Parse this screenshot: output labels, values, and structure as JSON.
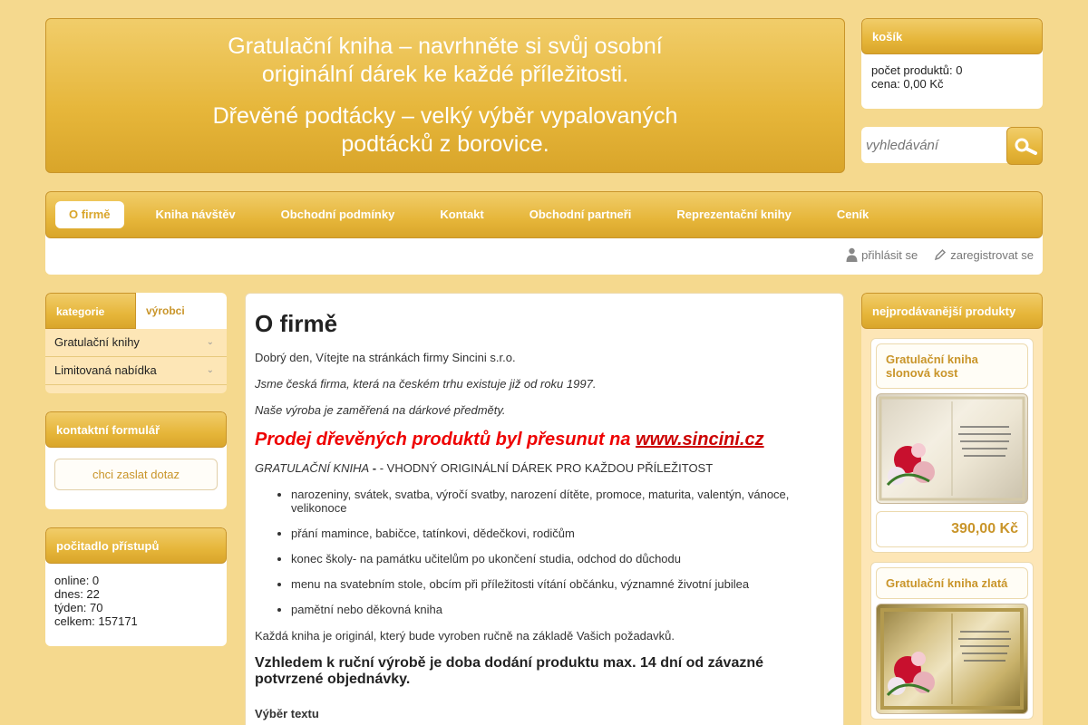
{
  "banner": {
    "line1": "Gratulační kniha – navrhněte si svůj osobní",
    "line2": "originální dárek ke každé příležitosti.",
    "line3": "Dřevěné podtácky – velký výběr vypalovaných",
    "line4": "podtácků z borovice."
  },
  "cart": {
    "title": "košík",
    "count_label": "počet produktů: 0",
    "price_label": "cena: 0,00 Kč"
  },
  "search": {
    "placeholder": "vyhledávání",
    "icon": "magnifier-icon"
  },
  "nav": {
    "items": [
      {
        "label": "O firmě",
        "active": true
      },
      {
        "label": "Kniha návštěv"
      },
      {
        "label": "Obchodní podmínky"
      },
      {
        "label": "Kontakt"
      },
      {
        "label": "Obchodní partneři"
      },
      {
        "label": "Reprezentační knihy"
      },
      {
        "label": "Ceník"
      }
    ]
  },
  "user": {
    "login": "přihlásit se",
    "register": "zaregistrovat se"
  },
  "categories": {
    "tab_active": "kategorie",
    "tab_inactive": "výrobci",
    "items": [
      "Gratulační knihy",
      "Limitovaná nabídka"
    ]
  },
  "contact": {
    "title": "kontaktní formulář",
    "button": "chci zaslat dotaz"
  },
  "counter": {
    "title": "počitadlo přístupů",
    "online": "online: 0",
    "today": "dnes: 22",
    "week": "týden: 70",
    "total": "celkem: 157171"
  },
  "main": {
    "title": "O firmě",
    "p1": "Dobrý den, Vítejte na stránkách firmy Sincini s.r.o.",
    "p2": "Jsme česká firma, která na českém trhu existuje již od roku 1997.",
    "p3": "Naše výroba je zaměřená na dárkové předměty.",
    "promo_text": "Prodej dřevěných produktů byl přesunut na ",
    "promo_link": "www.sincini.cz",
    "book_lead": "GRATULAČNÍ KNIHA",
    "book_rest": " - VHODNÝ ORIGINÁLNÍ DÁREK PRO KAŽDOU PŘÍLEŽITOST",
    "list": [
      "narozeniny, svátek, svatba, výročí svatby, narození dítěte, promoce, maturita, valentýn, vánoce, velikonoce",
      "přání mamince, babičce, tatínkovi, dědečkovi, rodičům",
      "konec školy- na památku učitelům po ukončení studia, odchod do důchodu",
      "menu na svatebním stole, obcím při příležitosti vítání občánku, významné životní jubilea",
      "pamětní nebo děkovná kniha"
    ],
    "p4": "Každá kniha je originál, který bude vyroben ručně na základě Vašich požadavků.",
    "h2": "Vzhledem k ruční výrobě je doba dodání produktu max. 14 dní od závazné potvrzené objednávky.",
    "h3": "Výběr textu"
  },
  "bestsellers": {
    "title": "nejprodávanější produkty",
    "products": [
      {
        "name": "Gratulační kniha slonová kost",
        "price": "390,00 Kč"
      },
      {
        "name": "Gratulační kniha zlatá"
      }
    ]
  },
  "colors": {
    "gold": "#e6b63a",
    "background": "#f5d98e",
    "promo": "#e00000"
  }
}
